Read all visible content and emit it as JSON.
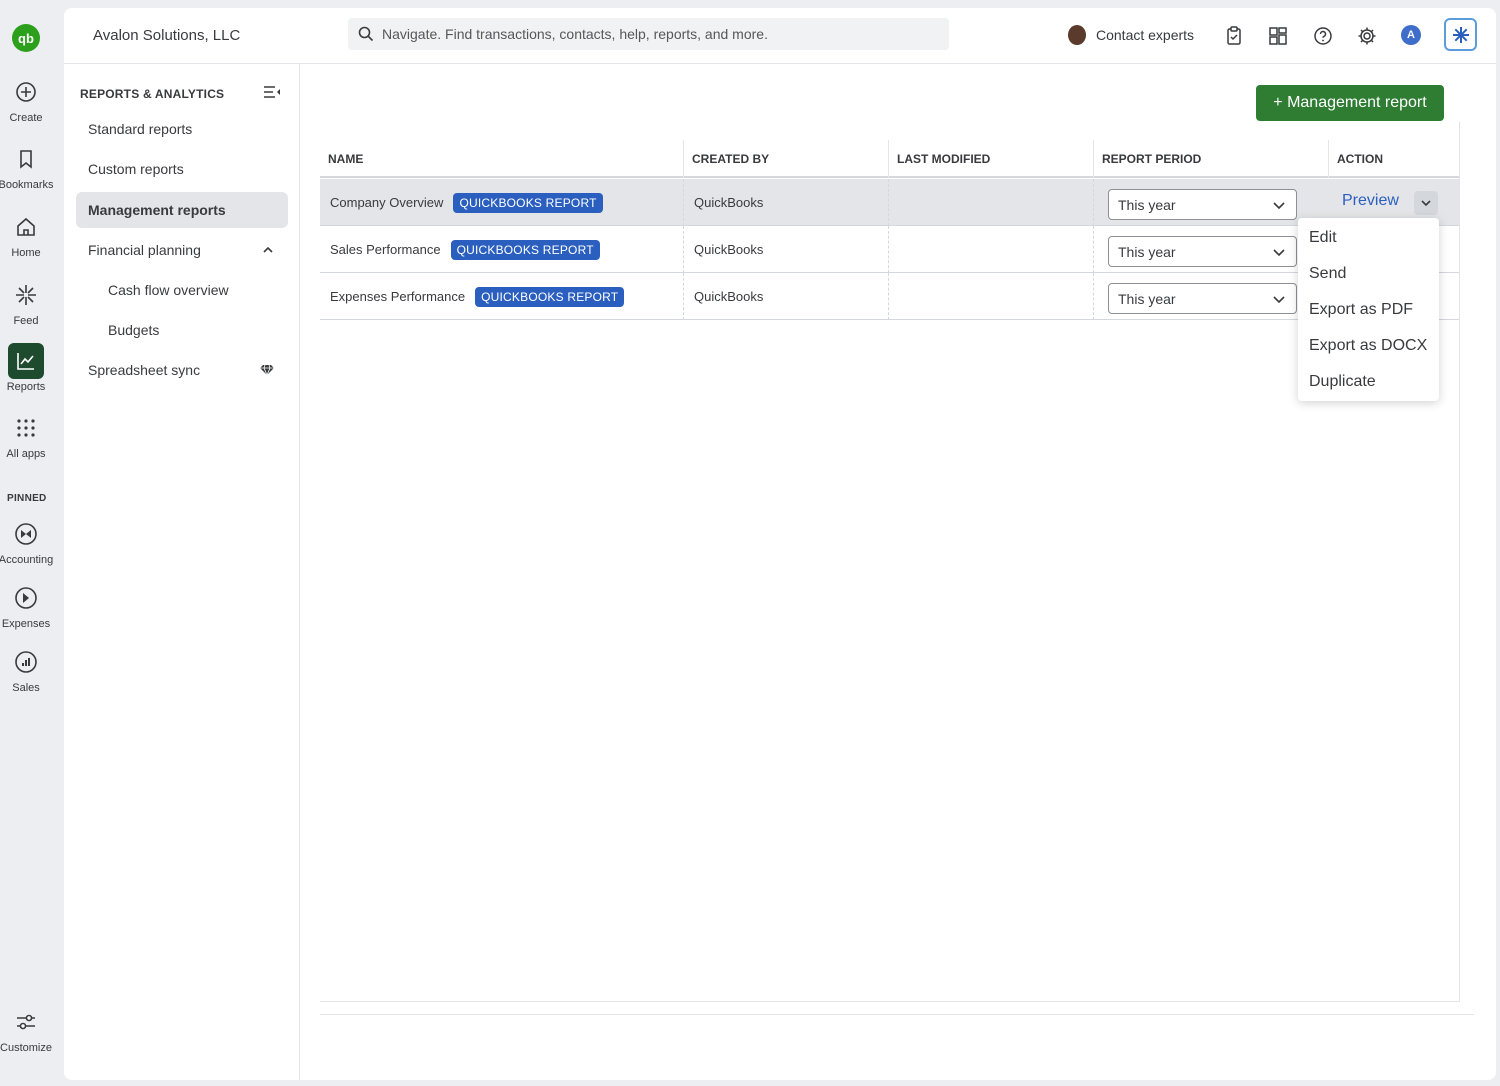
{
  "rail": {
    "logo": "qb",
    "items": [
      {
        "label": "Create",
        "icon": "plus-circle-icon"
      },
      {
        "label": "Bookmarks",
        "icon": "bookmark-icon"
      },
      {
        "label": "Home",
        "icon": "home-icon"
      },
      {
        "label": "Feed",
        "icon": "sparkle-icon"
      },
      {
        "label": "Reports",
        "icon": "chart-line-icon"
      },
      {
        "label": "All apps",
        "icon": "grid-dots-icon"
      }
    ],
    "pinned_label": "PINNED",
    "pinned": [
      {
        "label": "Accounting",
        "icon": "accounting-icon"
      },
      {
        "label": "Expenses",
        "icon": "expenses-icon"
      },
      {
        "label": "Sales",
        "icon": "sales-icon"
      }
    ],
    "customize": {
      "label": "Customize",
      "icon": "sliders-icon"
    }
  },
  "header": {
    "company": "Avalon Solutions, LLC",
    "search_placeholder": "Navigate. Find transactions, contacts, help, reports, and more.",
    "contact_label": "Contact experts",
    "user_initial": "A"
  },
  "subnav": {
    "title": "REPORTS & ANALYTICS",
    "items": [
      {
        "label": "Standard reports"
      },
      {
        "label": "Custom reports"
      },
      {
        "label": "Management reports"
      },
      {
        "label": "Financial planning"
      },
      {
        "label": "Cash flow overview"
      },
      {
        "label": "Budgets"
      },
      {
        "label": "Spreadsheet sync"
      }
    ]
  },
  "toolbar": {
    "new_report_label": "+ Management report"
  },
  "table": {
    "columns": [
      "NAME",
      "CREATED BY",
      "LAST MODIFIED",
      "REPORT PERIOD",
      "ACTION"
    ],
    "rows": [
      {
        "name": "Company Overview",
        "badge": "QUICKBOOKS REPORT",
        "created_by": "QuickBooks",
        "last_modified": "",
        "period": "This year",
        "action": "Preview"
      },
      {
        "name": "Sales Performance",
        "badge": "QUICKBOOKS REPORT",
        "created_by": "QuickBooks",
        "last_modified": "",
        "period": "This year",
        "action": ""
      },
      {
        "name": "Expenses Performance",
        "badge": "QUICKBOOKS REPORT",
        "created_by": "QuickBooks",
        "last_modified": "",
        "period": "This year",
        "action": ""
      }
    ]
  },
  "action_menu": {
    "items": [
      "Edit",
      "Send",
      "Export as PDF",
      "Export as DOCX",
      "Duplicate"
    ]
  },
  "colors": {
    "brand_green": "#2ca01c",
    "primary_button": "#2e7d32",
    "link_blue": "#2b5fbf",
    "badge_blue": "#2b5fbf"
  }
}
